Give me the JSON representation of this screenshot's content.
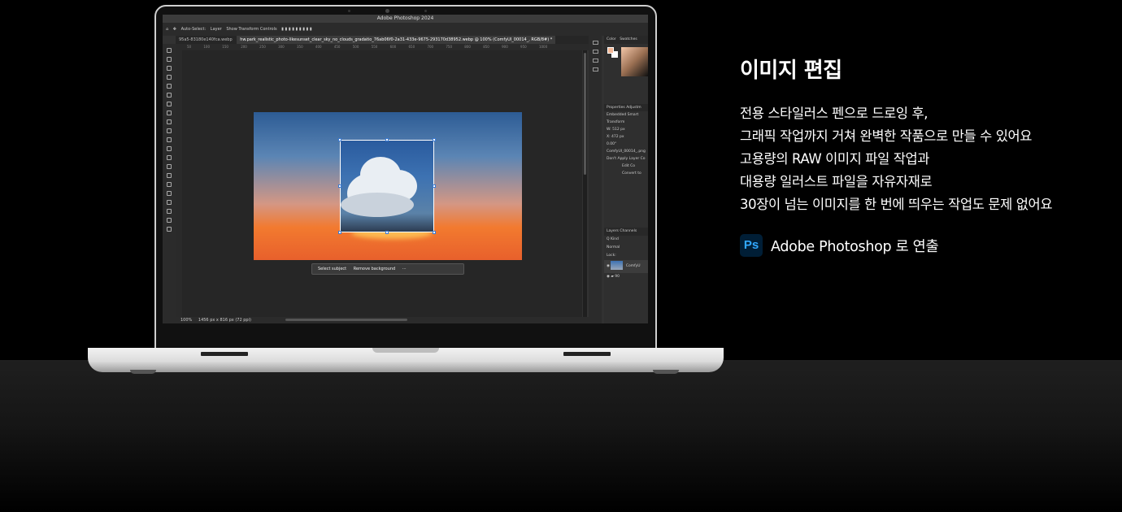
{
  "section": {
    "heading": "이미지 편집",
    "description_lines": [
      "전용 스타일러스 펜으로 드로잉 후,",
      "그래픽 작업까지 거쳐 완벽한 작품으로 만들 수 있어요",
      "고용량의 RAW 이미지 파일 작업과",
      "대용량 일러스트 파일을 자유자재로",
      "30장이 넘는 이미지를 한 번에 띄우는 작업도 문제 없어요"
    ],
    "credit": {
      "logo_text": "Ps",
      "text": "Adobe Photoshop 로 연출",
      "logo_color": "#31a8ff"
    }
  },
  "photoshop": {
    "window_title": "Adobe Photoshop 2024",
    "options_bar": [
      "Auto-Select:",
      "Layer",
      "Show Transform Controls"
    ],
    "tabs": [
      {
        "label": "95a5-83180e140fca.webp",
        "active": false
      },
      {
        "label": "hw.park_realistic_photo-likesunset_clear_sky_no_clouds_gradatio_76ab06f0-2a31-433e-9675-293170d38952.webp @ 100% (ComfyUI_00014_, RGB/8#) *",
        "active": true
      }
    ],
    "ruler_ticks": [
      "50",
      "100",
      "150",
      "200",
      "250",
      "300",
      "350",
      "400",
      "450",
      "500",
      "550",
      "600",
      "650",
      "700",
      "750",
      "800",
      "850",
      "900",
      "950",
      "1000"
    ],
    "status": {
      "zoom": "100%",
      "doc_size": "1456 px x 816 px (72 ppi)"
    },
    "context_bar": {
      "select_subject": "Select subject",
      "remove_background": "Remove background",
      "more": "···"
    },
    "panels": {
      "color_tabs": [
        "Color",
        "Swatches"
      ],
      "properties_tabs": [
        "Properties",
        "Adjustm"
      ],
      "embedded_label": "Embedded Smart",
      "transform_label": "Transform",
      "w_value": "W: 512 px",
      "x_value": "X: 472 px",
      "angle_value": "0.00°",
      "file_label": "ComfyUI_00014_.png",
      "note_label": "Don't Apply Layer Co",
      "edit_button": "Edit Co",
      "convert_button": "Convert to",
      "layers_tabs": [
        "Layers",
        "Channels"
      ],
      "kind_label": "Q Kind",
      "blend_mode": "Normal",
      "lock_label": "Lock:",
      "layer_name": "ComfyU",
      "group_name": "90"
    }
  }
}
